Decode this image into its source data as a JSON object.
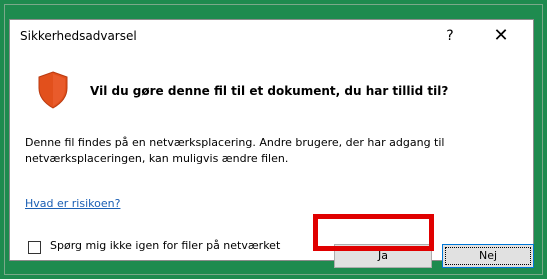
{
  "dialog": {
    "title": "Sikkerhedsadvarsel",
    "help_glyph": "?",
    "close_glyph": "✕",
    "question": "Vil du gøre denne fil til et dokument, du har tillid til?",
    "body_line1": "Denne fil findes på en netværksplacering. Andre brugere, der har adgang til",
    "body_line2": "netværksplaceringen, kan muligvis ændre filen.",
    "risk_link": "Hvad er risikoen?",
    "checkbox_label": "Spørg mig ikke igen for filer på netværket",
    "yes_label": "Ja",
    "no_label": "Nej",
    "checkbox_checked": false
  },
  "colors": {
    "background": "#1e8b4f",
    "shield_fill": "#e2501c",
    "link": "#1a5fb4",
    "highlight": "#e00000"
  },
  "icons": {
    "shield": "shield-warning-icon",
    "help": "help-icon",
    "close": "close-icon"
  }
}
